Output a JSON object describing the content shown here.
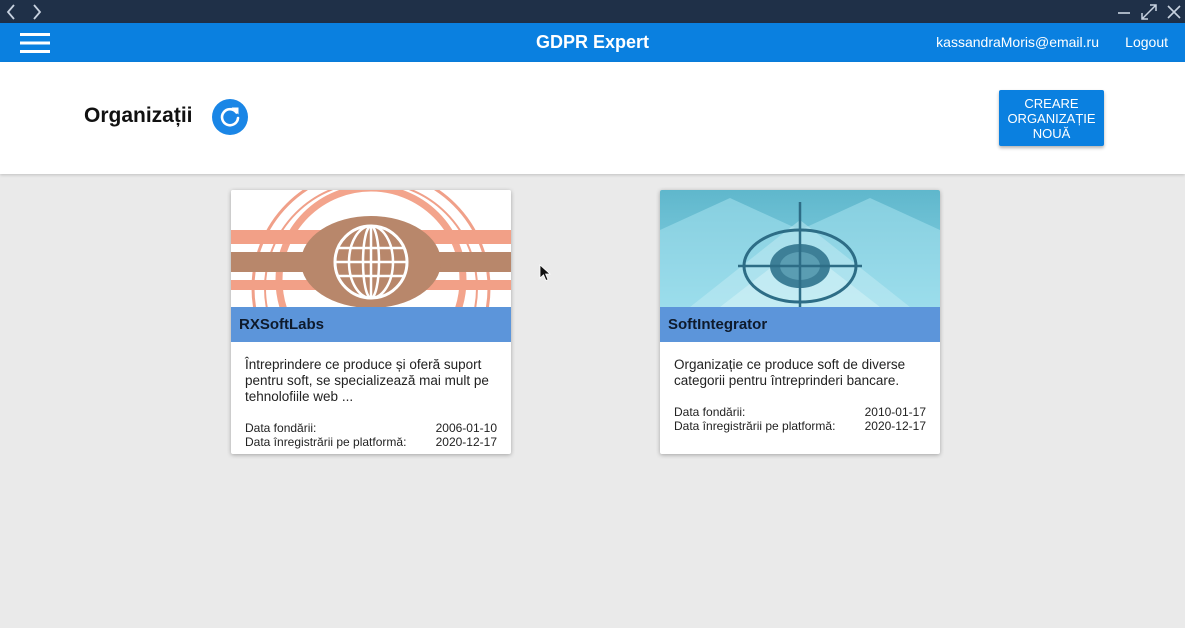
{
  "app": {
    "title": "GDPR Expert",
    "user_email": "kassandraMoris@email.ru",
    "logout_label": "Logout",
    "menu_icon": "hamburger-menu-icon"
  },
  "window": {
    "nav_back_icon": "chevron-left-icon",
    "nav_forward_icon": "chevron-right-icon",
    "minimize_icon": "minimize-icon",
    "maximize_icon": "maximize-icon",
    "close_icon": "close-icon"
  },
  "page": {
    "title": "Organizații",
    "refresh_icon": "refresh-icon",
    "create_button_label": "CREARE\nORGANIZAȚIE\nNOUĂ"
  },
  "organizations": [
    {
      "name": "RXSoftLabs",
      "description": "Întreprindere ce produce și oferă suport pentru soft, se specializează mai mult pe tehnolofiile web ...",
      "founded_label": "Data fondării:",
      "founded_value": "2006-01-10",
      "registered_label": "Data înregistrării pe platformă:",
      "registered_value": "2020-12-17",
      "image_icon": "globe-logo-icon"
    },
    {
      "name": "SoftIntegrator",
      "description": "Organizație ce produce soft de diverse categorii pentru întreprinderi bancare.",
      "founded_label": "Data fondării:",
      "founded_value": "2010-01-17",
      "registered_label": "Data înregistrării pe platformă:",
      "registered_value": "2020-12-17",
      "image_icon": "crosshair-logo-icon"
    }
  ],
  "colors": {
    "primary": "#0a80e0",
    "titlebar": "#1f3048",
    "card_name_bar": "#5c95da",
    "background": "#eaeaea"
  }
}
